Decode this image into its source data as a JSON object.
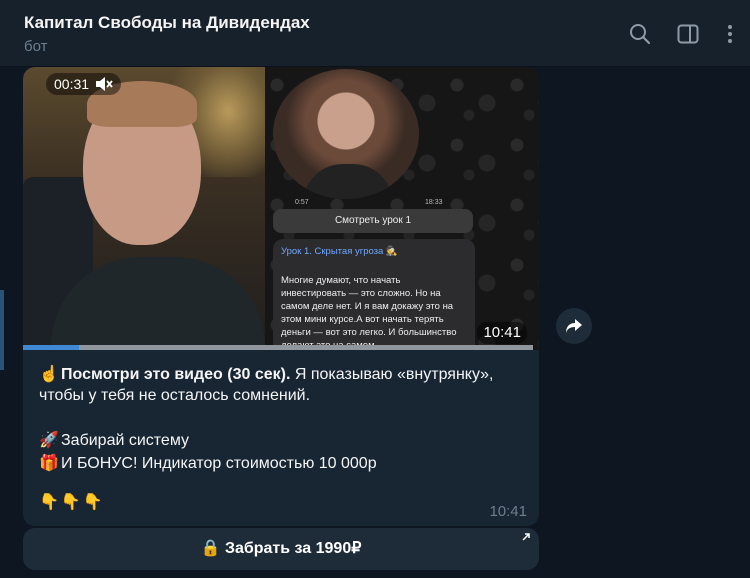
{
  "header": {
    "title": "Капитал Свободы на Дивидендах",
    "subtitle": "бот",
    "icons": [
      "search-icon",
      "sidebar-toggle-icon",
      "more-vertical-icon"
    ]
  },
  "video": {
    "elapsed": "00:31",
    "mute_icon": "muted-speaker-icon",
    "timestamp": "10:41",
    "progress": 0.11,
    "inner": {
      "circle_left": "0:57",
      "circle_right": "18:33",
      "watch_button": "Смотреть урок 1",
      "card_title": "Урок 1. Скрытая угроза 🕵",
      "card_text": "Многие думают, что начать инвестировать — это сложно. Но на самом деле нет. И я вам докажу это на этом мини курсе.А вот  начать терять деньги  — вот это легко. И большинство делают это на самом"
    }
  },
  "message": {
    "line1_bold": "Посмотри это видео (30 сек).",
    "line1_rest": " Я показываю «внутрянку»,",
    "line2": "чтобы у тебя не осталось сомнений.",
    "line3": "Забирай систему",
    "line4": "И БОНУС! Индикатор стоимостью 10 000р",
    "emoji_point_up": "☝️",
    "emoji_rocket": "🚀",
    "emoji_gift": "🎁",
    "emoji_down": "👇👇👇",
    "time": "10:41"
  },
  "button": {
    "label": "Забрать за 1990₽",
    "icon": "🔒"
  },
  "colors": {
    "bg": "#0e1621",
    "header": "#17212b",
    "bubble": "#182533",
    "accent": "#3e88d4"
  }
}
